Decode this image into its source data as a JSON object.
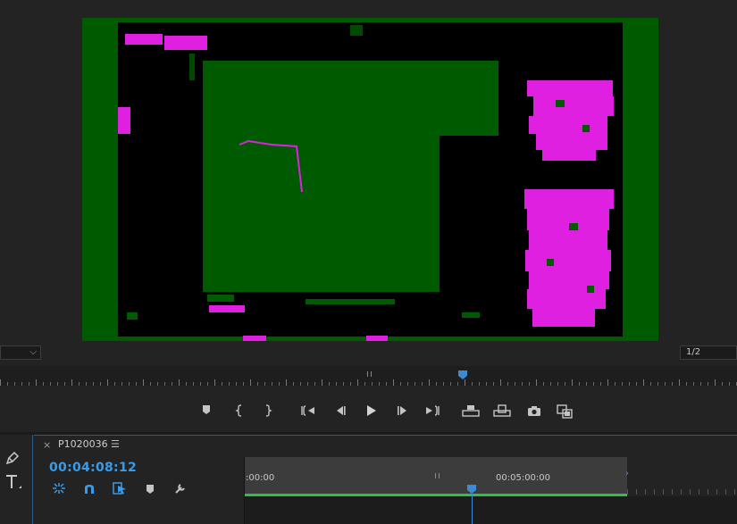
{
  "monitor": {
    "fit_value": "",
    "resolution_value": "1/2"
  },
  "transport": {
    "buttons": [
      "add-marker",
      "mark-in",
      "mark-out",
      "go-to-in",
      "step-back",
      "play",
      "step-forward",
      "go-to-out",
      "insert",
      "overwrite",
      "export-frame",
      "button-editor"
    ]
  },
  "tools": [
    "pen-tool",
    "type-tool"
  ],
  "timeline": {
    "sequence_name": "P1020036",
    "close_glyph": "×",
    "menu_glyph": "☰",
    "timecode": "00:04:08:12",
    "ruler_labels": [
      ":00:00",
      "00:05:00:00"
    ]
  },
  "colors": {
    "accent_blue": "#3a9be8",
    "workarea_green": "#2fbf4a",
    "frame_green": "#005a00",
    "frame_magenta": "#e020e0"
  }
}
